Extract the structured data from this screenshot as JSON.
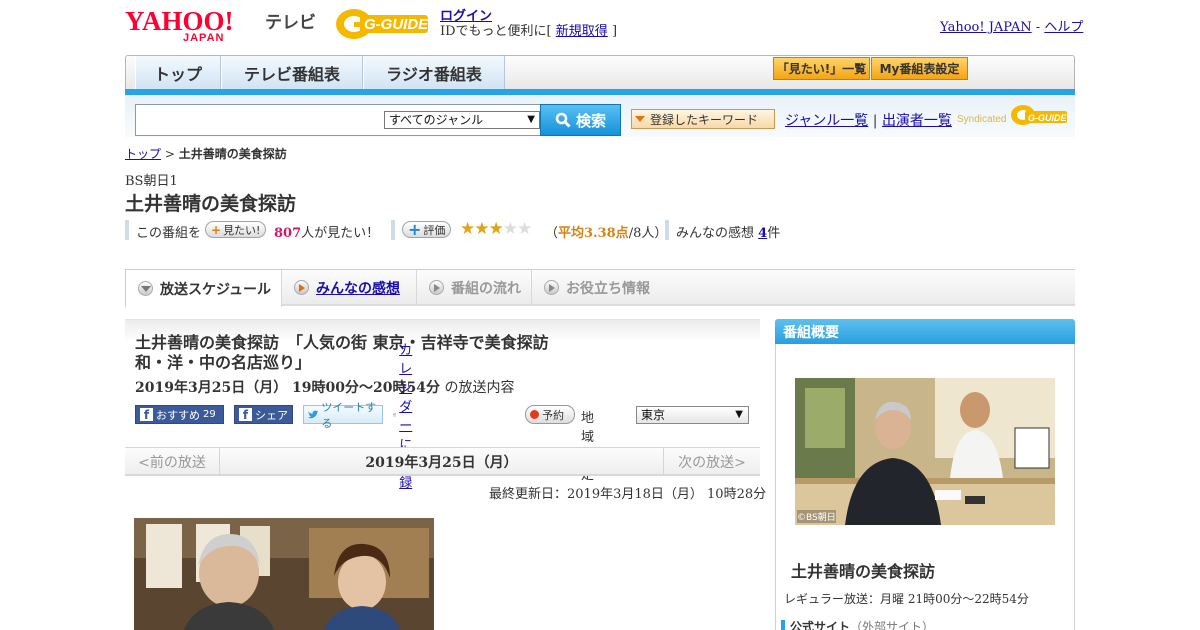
{
  "header": {
    "yahoo_logo_text": "YAHOO!",
    "japan_text": "JAPAN",
    "tv_label": "テレビ",
    "gguide_logo": "G-GUIDE",
    "login_label": "ログイン",
    "login_sub_prefix": "IDでもっと便利に[",
    "signup_label": "新規取得",
    "login_sub_suffix": "]",
    "yahoo_japan_link": "Yahoo! JAPAN",
    "separator": "-",
    "help_link": "ヘルプ"
  },
  "nav": {
    "tabs": [
      "トップ",
      "テレビ番組表",
      "ラジオ番組表"
    ],
    "tools": [
      "「見たい!」一覧",
      "My番組表設定"
    ]
  },
  "search": {
    "placeholder": "",
    "genre_selected": "すべてのジャンル",
    "search_button": "検索",
    "keyword_button": "登録したキーワード",
    "genre_list_link": "ジャンル一覧",
    "divider": "|",
    "cast_list_link": "出演者一覧",
    "syndicated_label": "Syndicated",
    "syndicated_logo": "G-GUIDE"
  },
  "breadcrumb": {
    "top": "トップ",
    "sep": ">",
    "current": "土井善晴の美食探訪"
  },
  "program": {
    "channel": "BS朝日1",
    "title": "土井善晴の美食探訪"
  },
  "stats": {
    "this_program": "この番組を",
    "want_button": "見たい!",
    "want_count": "807",
    "want_suffix": "人が見たい！",
    "rating_button": "評価",
    "rating_stars_filled": 3,
    "rating_stars_total": 5,
    "rating_open": "（",
    "rating_avg_label": "平均3.38点",
    "rating_count": "/8人）",
    "impressions_label": "みんなの感想",
    "impressions_count": "4",
    "impressions_suffix": "件"
  },
  "content_tabs": [
    {
      "label": "放送スケジュール",
      "state": "active"
    },
    {
      "label": "みんなの感想",
      "state": "link"
    },
    {
      "label": "番組の流れ",
      "state": "disabled"
    },
    {
      "label": "お役立ち情報",
      "state": "disabled"
    }
  ],
  "episode": {
    "title_line1": "土井善晴の美食探訪　「人気の街 東京・吉祥寺で美食探訪",
    "title_line2": "和・洋・中の名店巡り」",
    "date_time": "2019年3月25日（月） 19時00分～20時54分",
    "date_suffix": "の放送内容",
    "fb_recommend": "おすすめ",
    "fb_recommend_count": "29",
    "fb_share": "シェア",
    "tweet": "ツイートする",
    "calendar": "カレンダーに登録",
    "reserve": "予約",
    "region_label": "地域設定",
    "region_selected": "東京"
  },
  "date_nav": {
    "prev": "<前の放送",
    "current": "2019年3月25日（月）",
    "next": "次の放送>"
  },
  "updated": "最終更新日：2019年3月18日（月） 10時28分",
  "sidebar": {
    "heading": "番組概要",
    "photo_credit": "©BS朝日",
    "title": "土井善晴の美食探訪",
    "regular": "レギュラー放送：月曜 21時00分～22時54分",
    "official_site": "公式サイト",
    "external": "（外部サイト）"
  },
  "colors": {
    "accent_blue": "#27a4e6",
    "want_count": "#d4166a",
    "rating_avg": "#d58316",
    "star": "#e2a31a"
  }
}
